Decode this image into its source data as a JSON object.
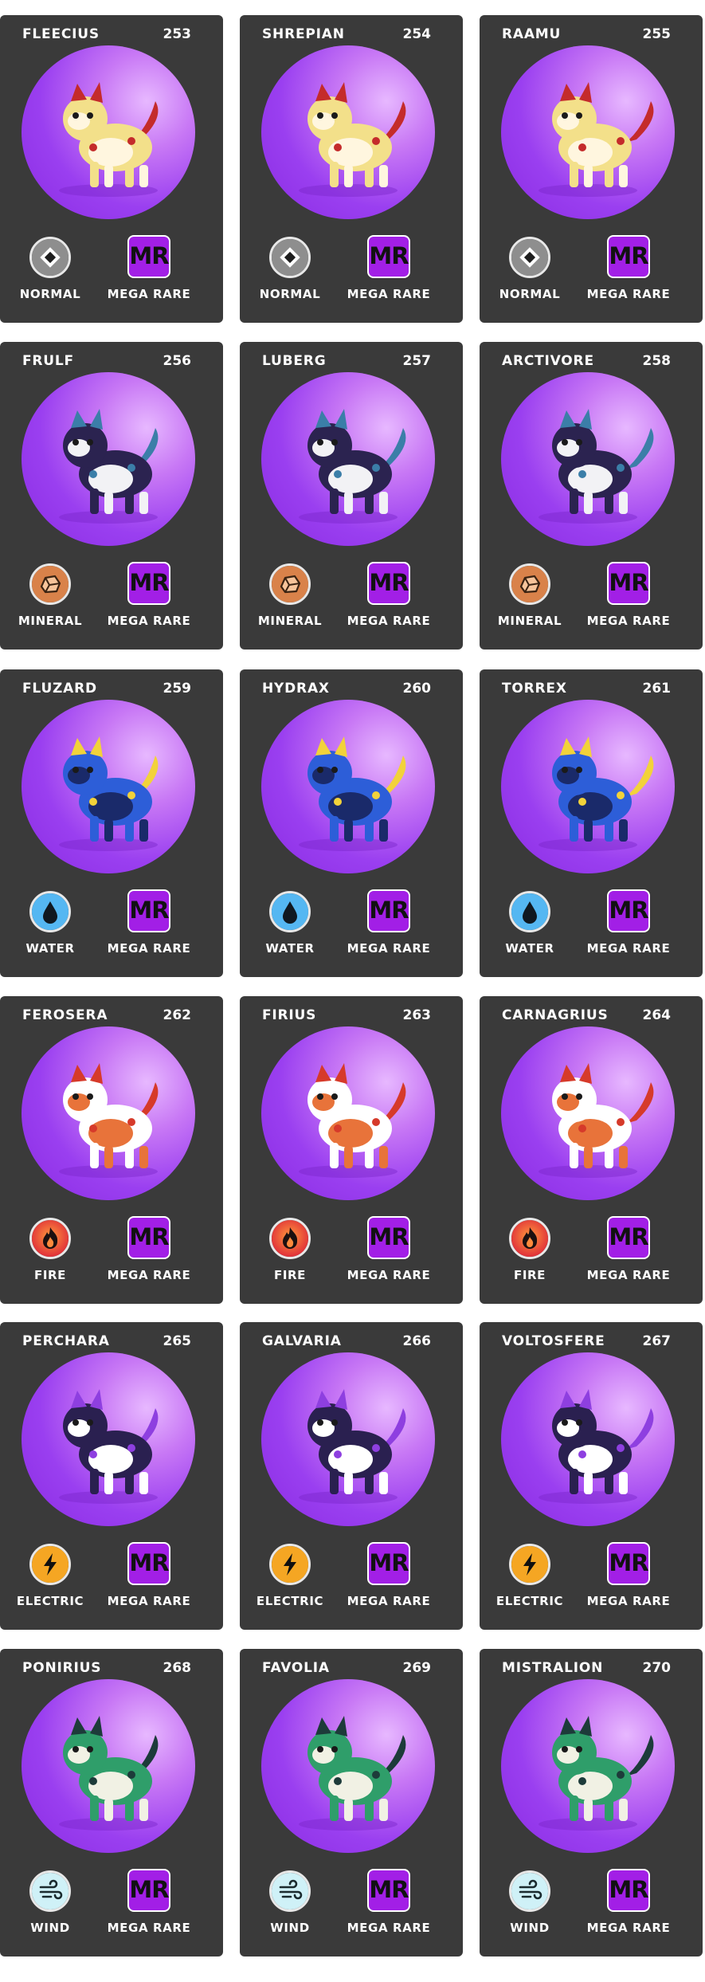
{
  "rarity": {
    "code": "MR",
    "label": "MEGA RARE",
    "color": "#a21fe6"
  },
  "types": {
    "normal": {
      "label": "NORMAL",
      "icon": "diamond-icon",
      "color": "#9a9a9a"
    },
    "mineral": {
      "label": "MINERAL",
      "icon": "rock-icon",
      "color": "#d9824a"
    },
    "water": {
      "label": "WATER",
      "icon": "drop-icon",
      "color": "#55b7f2"
    },
    "fire": {
      "label": "FIRE",
      "icon": "flame-icon",
      "color": "#e84a3a"
    },
    "electric": {
      "label": "ELECTRIC",
      "icon": "bolt-icon",
      "color": "#f5a623"
    },
    "wind": {
      "label": "WIND",
      "icon": "wind-icon",
      "color": "#bfeaf2"
    }
  },
  "cards": [
    {
      "name": "FLEECIUS",
      "number": "253",
      "type": "normal"
    },
    {
      "name": "SHREPIAN",
      "number": "254",
      "type": "normal"
    },
    {
      "name": "RAAMU",
      "number": "255",
      "type": "normal"
    },
    {
      "name": "FRULF",
      "number": "256",
      "type": "mineral"
    },
    {
      "name": "LUBERG",
      "number": "257",
      "type": "mineral"
    },
    {
      "name": "ARCTIVORE",
      "number": "258",
      "type": "mineral"
    },
    {
      "name": "FLUZARD",
      "number": "259",
      "type": "water"
    },
    {
      "name": "HYDRAX",
      "number": "260",
      "type": "water"
    },
    {
      "name": "TORREX",
      "number": "261",
      "type": "water"
    },
    {
      "name": "FEROSERA",
      "number": "262",
      "type": "fire"
    },
    {
      "name": "FIRIUS",
      "number": "263",
      "type": "fire"
    },
    {
      "name": "CARNAGRIUS",
      "number": "264",
      "type": "fire"
    },
    {
      "name": "PERCHARA",
      "number": "265",
      "type": "electric"
    },
    {
      "name": "GALVARIA",
      "number": "266",
      "type": "electric"
    },
    {
      "name": "VOLTOSFERE",
      "number": "267",
      "type": "electric"
    },
    {
      "name": "PONIRIUS",
      "number": "268",
      "type": "wind"
    },
    {
      "name": "FAVOLIA",
      "number": "269",
      "type": "wind"
    },
    {
      "name": "MISTRALION",
      "number": "270",
      "type": "wind"
    }
  ]
}
